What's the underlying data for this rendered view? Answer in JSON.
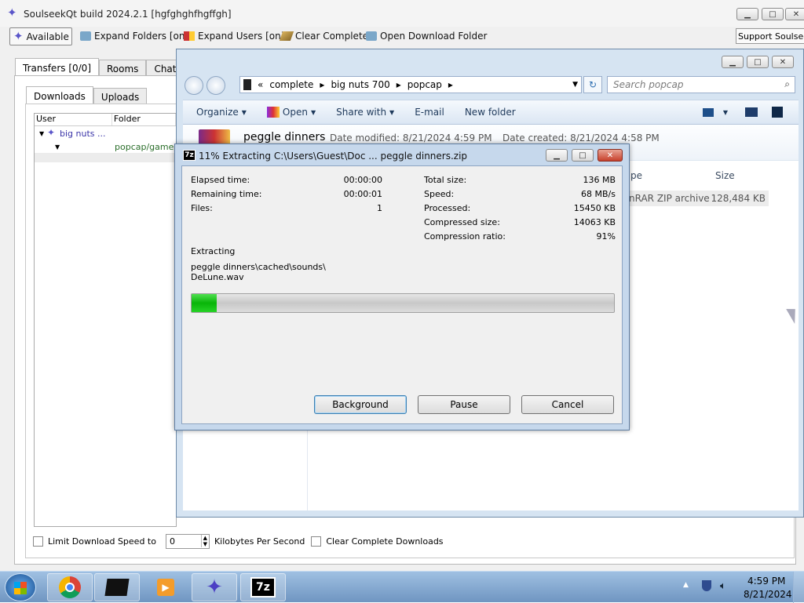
{
  "soulseek": {
    "title": "SoulseekQt build 2024.2.1 [hgfghghfhgffgh]",
    "toolbar": {
      "available": "Available",
      "expand_folders": "Expand Folders [on]",
      "expand_users": "Expand Users [on]",
      "clear_complete": "Clear Complete",
      "open_download_folder": "Open Download Folder",
      "support": "Support Soulseek"
    },
    "tabs": [
      "Transfers [0/0]",
      "Rooms",
      "Chat"
    ],
    "subtabs": [
      "Downloads",
      "Uploads"
    ],
    "columns": [
      "User",
      "Folder"
    ],
    "rows": {
      "user": "big nuts ...",
      "folder": "popcap/games"
    },
    "bottom": {
      "limit_label": "Limit Download Speed to",
      "speed_value": "0",
      "unit": "Kilobytes Per Second",
      "clear_complete_label": "Clear Complete Downloads"
    }
  },
  "explorer": {
    "breadcrumb": [
      "complete",
      "big nuts 700",
      "popcap"
    ],
    "search_placeholder": "Search popcap",
    "commands": [
      "Organize",
      "Open",
      "Share with",
      "E-mail",
      "New folder"
    ],
    "file": {
      "name": "peggle dinners",
      "date_modified": "Date modified: 8/21/2024 4:59 PM",
      "date_created": "Date created: 8/21/2024 4:58 PM",
      "type_col": "pe",
      "size_col": "Size",
      "type": "nRAR ZIP archive",
      "size": "128,484 KB"
    }
  },
  "zip_dialog": {
    "title": "11% Extracting C:\\Users\\Guest\\Doc ... peggle dinners.zip",
    "progress_fraction": 0.06,
    "left": [
      {
        "label": "Elapsed time:",
        "value": "00:00:00"
      },
      {
        "label": "Remaining time:",
        "value": "00:00:01"
      },
      {
        "label": "Files:",
        "value": "1"
      }
    ],
    "right": [
      {
        "label": "Total size:",
        "value": "136 MB"
      },
      {
        "label": "Speed:",
        "value": "68 MB/s"
      },
      {
        "label": "Processed:",
        "value": "15450 KB"
      },
      {
        "label": "Compressed size:",
        "value": "14063 KB"
      },
      {
        "label": "Compression ratio:",
        "value": "91%"
      }
    ],
    "extracting_label": "Extracting",
    "path_line1": "peggle dinners\\cached\\sounds\\",
    "path_line2": "DeLune.wav",
    "buttons": {
      "background": "Background",
      "pause": "Pause",
      "cancel": "Cancel"
    },
    "icon_text": "7z"
  },
  "taskbar": {
    "time": "4:59 PM",
    "date": "8/21/2024",
    "zip_icon_text": "7z"
  }
}
